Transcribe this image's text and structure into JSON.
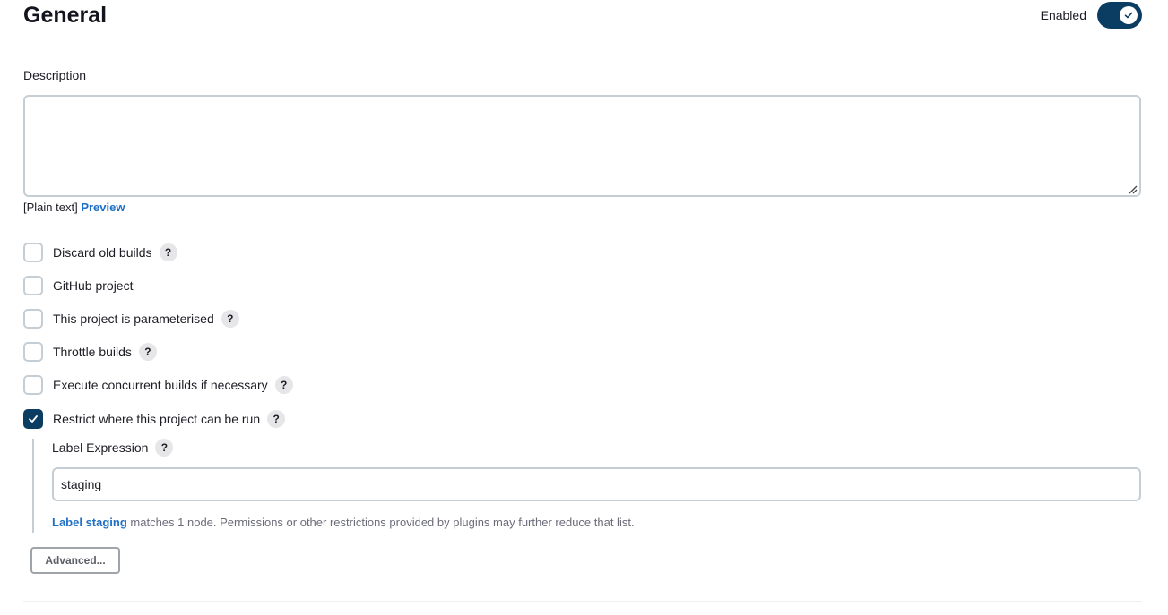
{
  "header": {
    "title": "General",
    "enabled_label": "Enabled",
    "enabled": true
  },
  "description": {
    "label": "Description",
    "value": "",
    "format_text": "[Plain text]",
    "preview_link": "Preview"
  },
  "options": [
    {
      "label": "Discard old builds",
      "checked": false,
      "help": true
    },
    {
      "label": "GitHub project",
      "checked": false,
      "help": false
    },
    {
      "label": "This project is parameterised",
      "checked": false,
      "help": true
    },
    {
      "label": "Throttle builds",
      "checked": false,
      "help": true
    },
    {
      "label": "Execute concurrent builds if necessary",
      "checked": false,
      "help": true
    },
    {
      "label": "Restrict where this project can be run",
      "checked": true,
      "help": true
    }
  ],
  "help_glyph": "?",
  "restrict": {
    "label_expression_label": "Label Expression",
    "label_expression_value": "staging",
    "match_link": "Label staging",
    "match_text": " matches 1 node. Permissions or other restrictions provided by plugins may further reduce that list."
  },
  "advanced_button": "Advanced...",
  "colors": {
    "accent": "#0b3d63",
    "link": "#1f6fc5",
    "border": "#c5ced4"
  }
}
